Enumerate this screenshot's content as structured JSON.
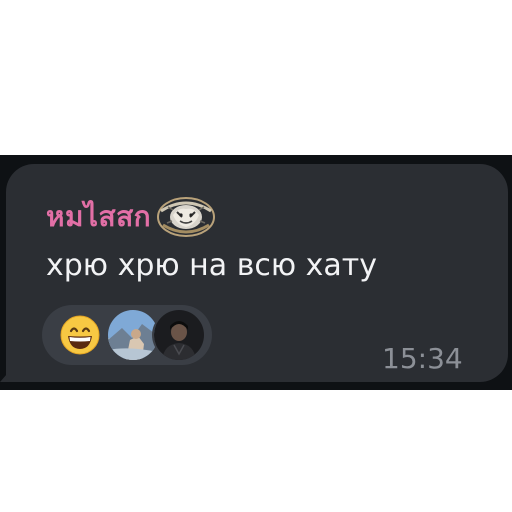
{
  "message": {
    "sender_name": "หมไสสก",
    "text": "хрю хрю на всю хату",
    "time": "15:34",
    "reaction": {
      "emoji_name": "grinning-face-with-smiling-eyes",
      "reactor_count": 2
    }
  },
  "colors": {
    "chat_background": "#0e1114",
    "bubble": "#2b2e33",
    "sender_name": "#e26fa6",
    "message_text": "#f2f3f5",
    "reaction_pill": "#3a3e45",
    "timestamp": "#8c9097"
  },
  "icons": {
    "sender_badge": "tiger-emblem-icon",
    "reaction": "grinning-emoji-icon"
  }
}
